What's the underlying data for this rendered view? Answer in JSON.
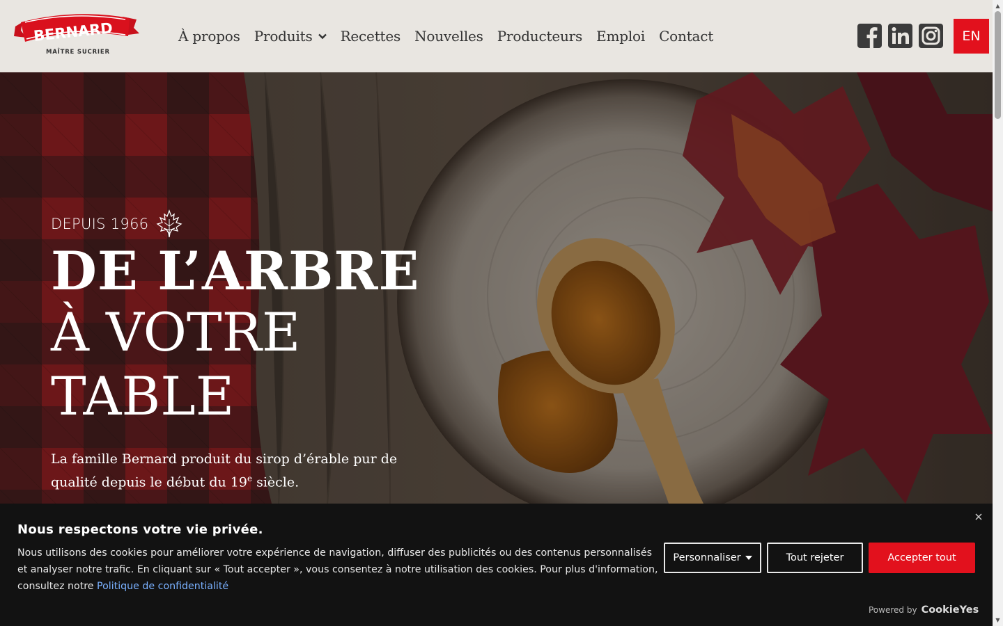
{
  "brand": {
    "logo_text": "BERNARD",
    "logo_tagline": "MAÎTRE SUCRIER",
    "primary_color": "#e2111d"
  },
  "nav": {
    "items": [
      {
        "label": "À propos"
      },
      {
        "label": "Produits",
        "has_dropdown": true
      },
      {
        "label": "Recettes"
      },
      {
        "label": "Nouvelles"
      },
      {
        "label": "Producteurs"
      },
      {
        "label": "Emploi"
      },
      {
        "label": "Contact"
      }
    ]
  },
  "socials": [
    {
      "icon": "facebook-icon"
    },
    {
      "icon": "linkedin-icon"
    },
    {
      "icon": "instagram-icon"
    }
  ],
  "language_switch": "EN",
  "hero": {
    "kicker": "DEPUIS 1966",
    "title_line1": "DE L’ARBRE",
    "title_line2": "À VOTRE",
    "title_line3": "TABLE",
    "lead_part1": "La famille Bernard produit du sirop d’érable pur de qualité depuis le début du 19",
    "lead_sup": "e",
    "lead_part2": " siècle."
  },
  "cookie_banner": {
    "title": "Nous respectons votre vie privée.",
    "body": "Nous utilisons des cookies pour améliorer votre expérience de navigation, diffuser des publicités ou des contenus personnalisés et analyser notre trafic. En cliquant sur « Tout accepter », vous consentez à notre utilisation des cookies.  Pour plus d'information, consultez notre ",
    "link": "Politique de confidentialité",
    "buttons": {
      "customize": "Personnaliser",
      "reject": "Tout rejeter",
      "accept": "Accepter tout"
    },
    "powered_by": "Powered by",
    "powered_brand": "CookieYes"
  }
}
